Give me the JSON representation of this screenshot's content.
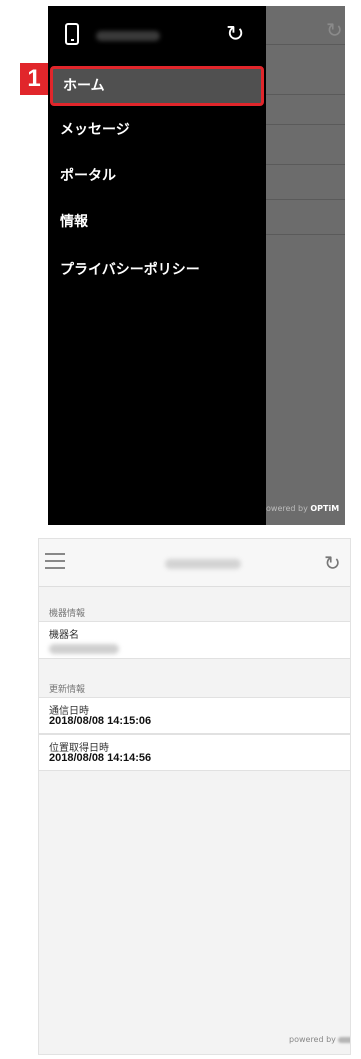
{
  "callout": {
    "number": "1"
  },
  "menu": {
    "refresh_icon": "refresh-icon",
    "device_icon": "smartphone-icon",
    "items": [
      {
        "label": "ホーム",
        "selected": true
      },
      {
        "label": "メッセージ"
      },
      {
        "label": "ポータル"
      },
      {
        "label": "情報"
      },
      {
        "label": "プライバシーポリシー"
      }
    ],
    "powered_prefix": "owered by ",
    "powered_brand": "OPTiM"
  },
  "detail": {
    "menu_icon": "hamburger-menu-icon",
    "refresh_icon": "refresh-icon",
    "device_section": "機器情報",
    "device_name_label": "機器名",
    "update_section": "更新情報",
    "comm_label": "通信日時",
    "comm_value": "2018/08/08 14:15:06",
    "loc_label": "位置取得日時",
    "loc_value": "2018/08/08 14:14:56",
    "powered_prefix": "powered by"
  },
  "colors": {
    "highlight": "#e1262b",
    "menu_bg": "#000000",
    "selected_bg": "#505050"
  }
}
